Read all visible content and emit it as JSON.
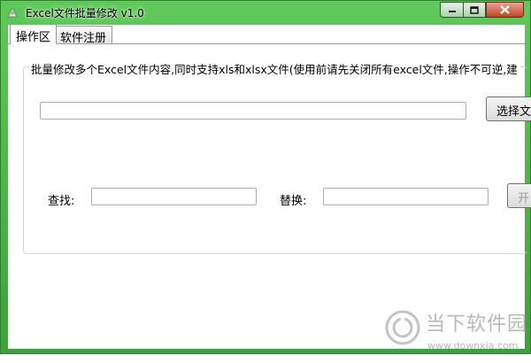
{
  "window": {
    "title": "Excel文件批量修改 v1.0",
    "accent_color": "#4db849",
    "icon": "app-icon"
  },
  "tabs": [
    {
      "label": "操作区",
      "active": true
    },
    {
      "label": "软件注册",
      "active": false
    }
  ],
  "main": {
    "description": "批量修改多个Excel文件内容,同时支持xls和xlsx文件(使用前请先关闭所有excel文件,操作不可逆,建",
    "file_path_value": "",
    "select_button_label": "选择文",
    "find_label": "查找:",
    "find_value": "",
    "replace_label": "替换:",
    "replace_value": "",
    "execute_button_label": "开"
  },
  "watermark": {
    "name": "当下软件园",
    "url": "www.downxia.com"
  }
}
